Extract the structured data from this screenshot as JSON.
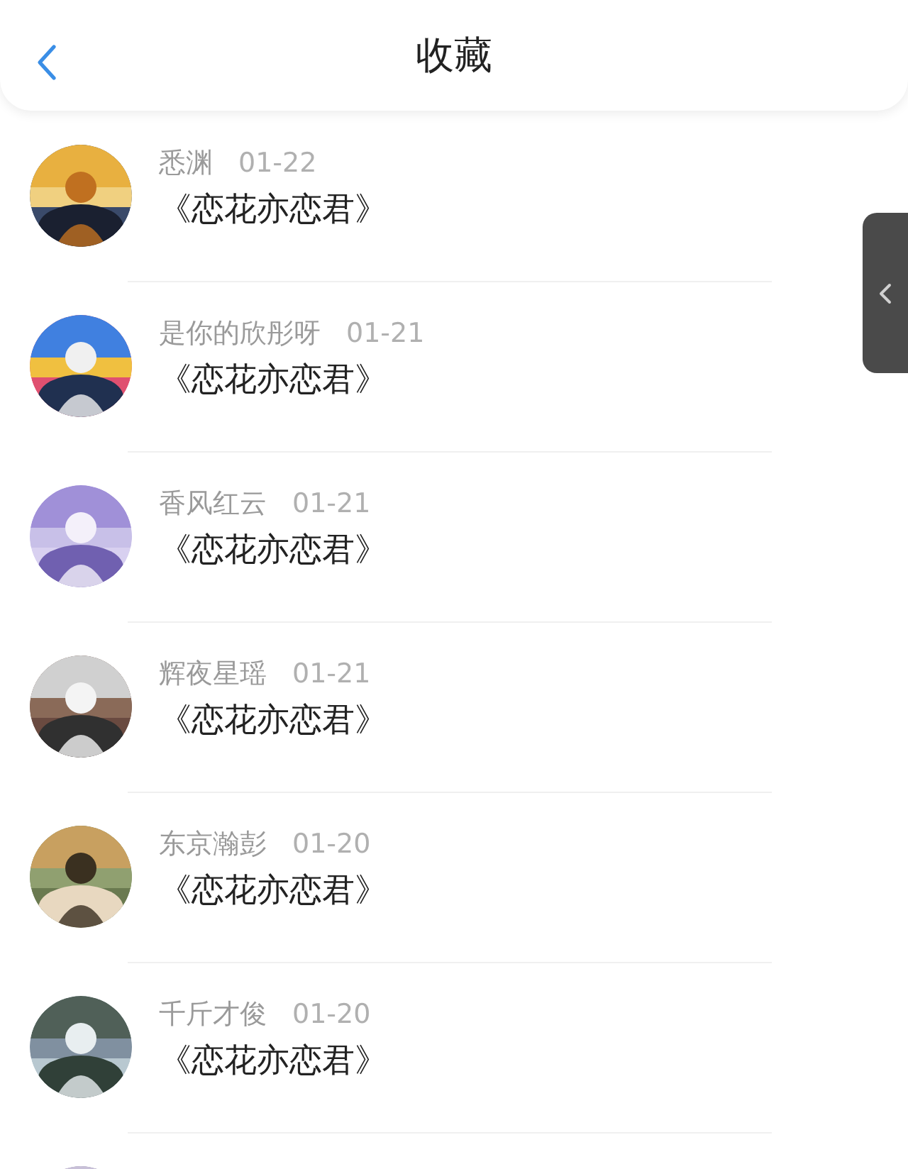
{
  "header": {
    "title": "收藏"
  },
  "items": [
    {
      "author": "悉渊",
      "date": "01-22",
      "title": "《恋花亦恋君》"
    },
    {
      "author": "是你的欣彤呀",
      "date": "01-21",
      "title": "《恋花亦恋君》"
    },
    {
      "author": "香风红云",
      "date": "01-21",
      "title": "《恋花亦恋君》"
    },
    {
      "author": "辉夜星瑶",
      "date": "01-21",
      "title": "《恋花亦恋君》"
    },
    {
      "author": "东京瀚彭",
      "date": "01-20",
      "title": "《恋花亦恋君》"
    },
    {
      "author": "千斤才俊",
      "date": "01-20",
      "title": "《恋花亦恋君》"
    }
  ]
}
